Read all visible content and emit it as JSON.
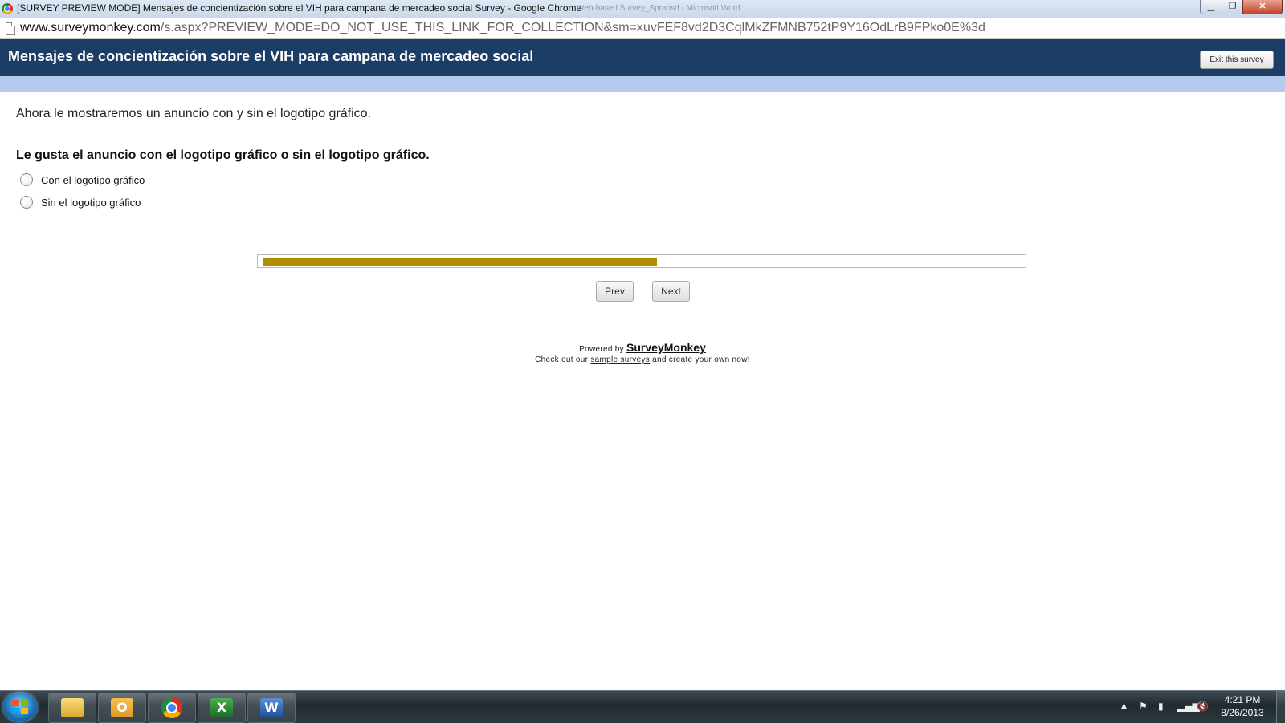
{
  "window": {
    "title": "[SURVEY PREVIEW MODE] Mensajes de concientización sobre el VIH para campana de mercadeo social Survey - Google Chrome",
    "ghost_text": "Web-based Survey_Sprabsd  -  Microsoft Word",
    "min_glyph": "▁",
    "max_glyph": "❐",
    "close_glyph": "✕"
  },
  "address_bar": {
    "domain": "www.surveymonkey.com",
    "path": "/s.aspx?PREVIEW_MODE=DO_NOT_USE_THIS_LINK_FOR_COLLECTION&sm=xuvFEF8vd2D3CqlMkZFMNB752tP9Y16OdLrB9FPko0E%3d"
  },
  "survey": {
    "title": "Mensajes de concientización sobre el VIH para campana de mercadeo social",
    "exit_label": "Exit this survey",
    "intro": "Ahora le mostraremos un anuncio con y sin el logotipo gráfico.",
    "question": "Le gusta el anuncio con el logotipo gráfico o sin el logotipo gráfico.",
    "options": [
      {
        "label": "Con el logotipo gráfico",
        "selected": false
      },
      {
        "label": "Sin el logotipo gráfico",
        "selected": false
      }
    ],
    "progress_fraction": 0.52,
    "progress_color": "#b08f00",
    "prev_label": "Prev",
    "next_label": "Next"
  },
  "footer": {
    "powered_by": "Powered by",
    "brand": "SurveyMonkey",
    "checkout_prefix": "Check out our",
    "checkout_link": "sample surveys",
    "checkout_suffix": "and create your own now!"
  },
  "taskbar": {
    "apps": [
      "windows-explorer",
      "outlook",
      "google-chrome",
      "excel",
      "word"
    ],
    "excel_letter": "X",
    "word_letter": "W",
    "outlook_letter": "O",
    "tray_up": "▲",
    "tray_flag": "⚑",
    "tray_power": "▮",
    "tray_network": "▂▄▆",
    "tray_sound": "🔇",
    "time": "4:21 PM",
    "date": "8/26/2013"
  },
  "colors": {
    "header_bg": "#1c3d66",
    "header_band": "#b4cbee"
  }
}
